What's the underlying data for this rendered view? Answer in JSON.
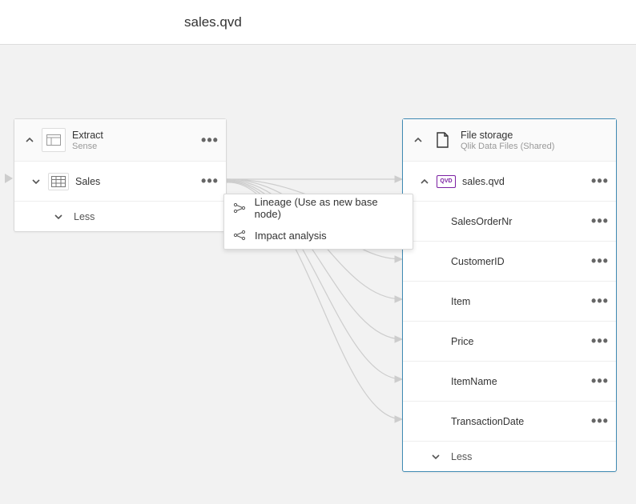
{
  "header": {
    "title": "sales.qvd"
  },
  "leftCard": {
    "title": "Extract",
    "subtitle": "Sense",
    "tableName": "Sales",
    "less": "Less"
  },
  "rightCard": {
    "title": "File storage",
    "subtitle": "Qlik Data Files (Shared)",
    "fileName": "sales.qvd",
    "badge": "QVD",
    "fields": [
      "SalesOrderNr",
      "CustomerID",
      "Item",
      "Price",
      "ItemName",
      "TransactionDate"
    ],
    "less": "Less"
  },
  "contextMenu": {
    "items": [
      "Lineage (Use as new base node)",
      "Impact analysis"
    ]
  }
}
